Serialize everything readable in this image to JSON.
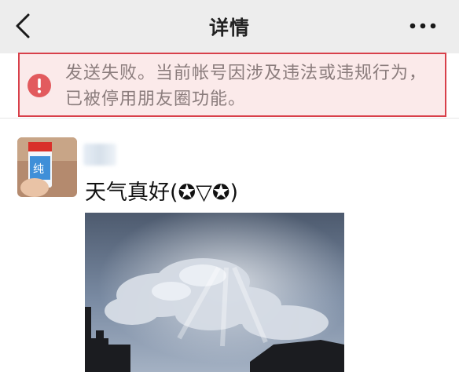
{
  "header": {
    "title": "详情",
    "back_icon": "chevron-left-icon",
    "more_icon": "more-dots-icon"
  },
  "alert": {
    "icon": "exclamation-circle-icon",
    "message": "发送失败。当前帐号因涉及违法或违规行为，已被停用朋友圈功能。",
    "accent_color": "#d8404a"
  },
  "post": {
    "avatar_icon": "user-avatar-photo",
    "text": "天气真好(✪▽✪)",
    "image_icon": "sky-clouds-photo"
  }
}
